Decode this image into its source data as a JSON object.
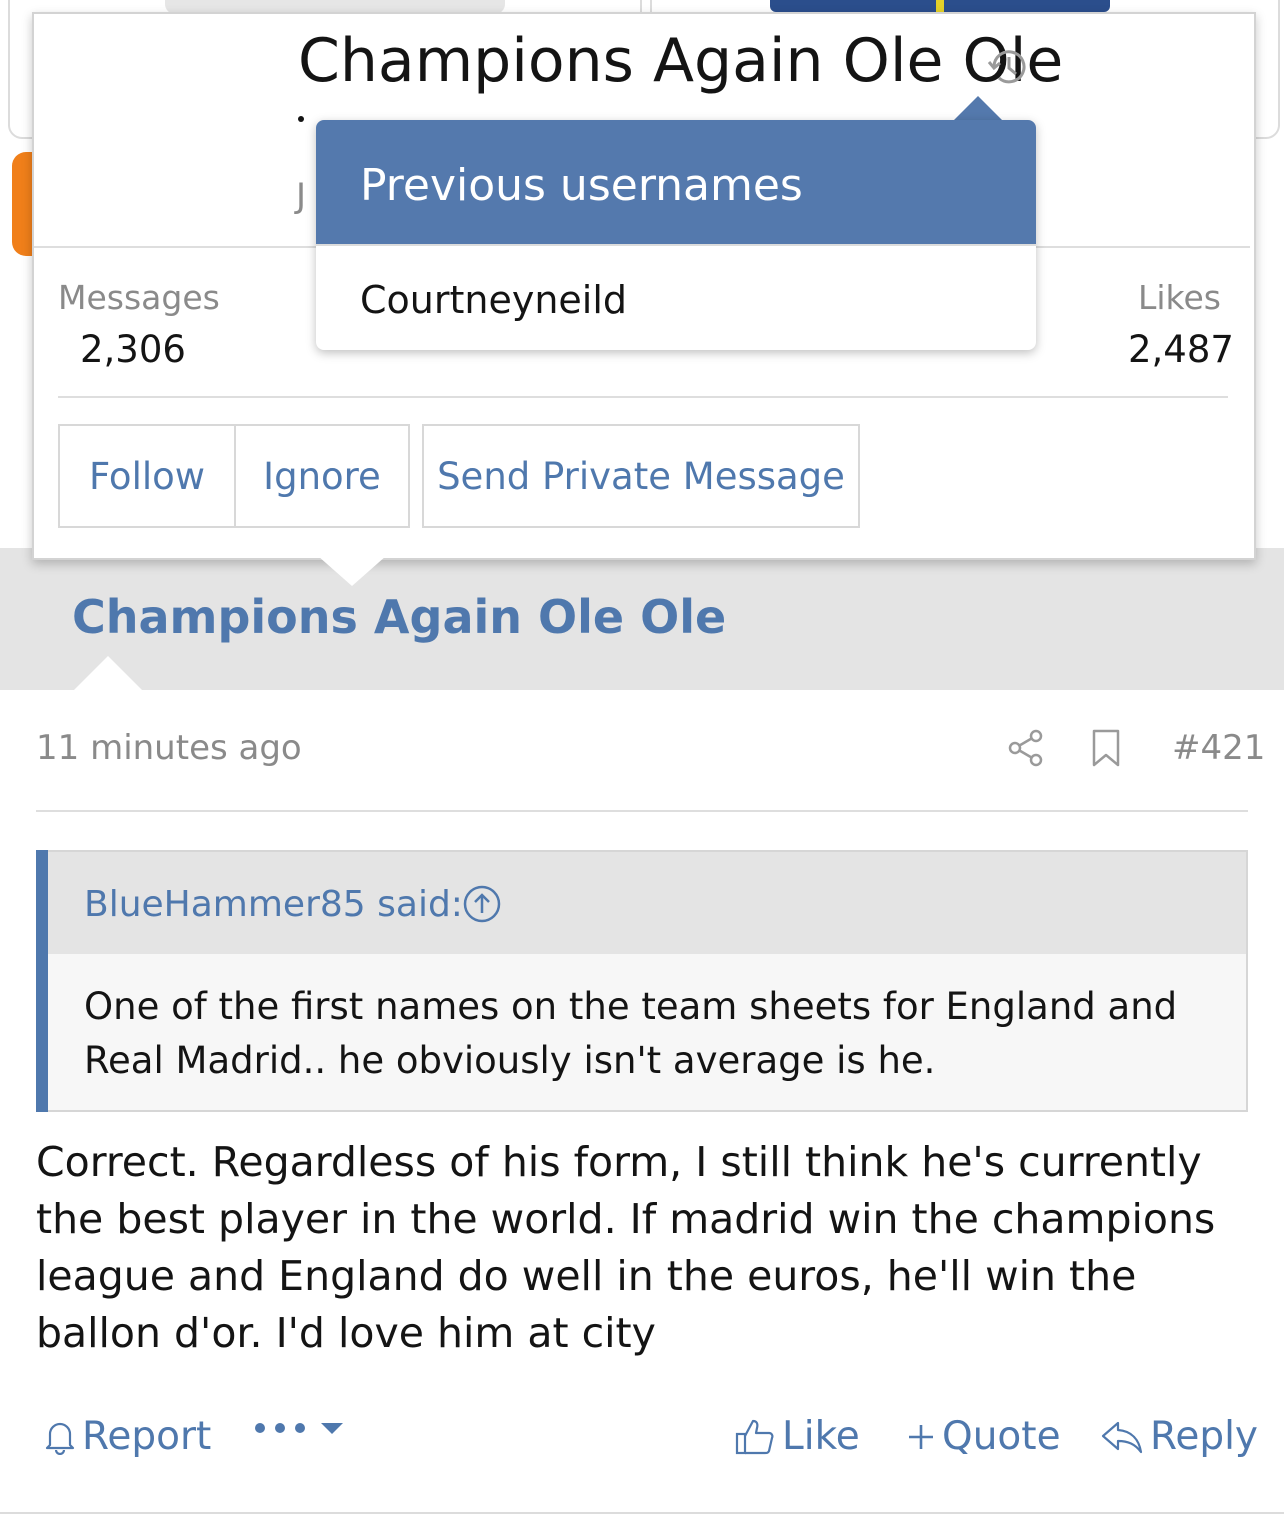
{
  "member_card": {
    "title": "Champions Again Ole Ole",
    "initial": "J",
    "stats": {
      "messages_label": "Messages",
      "messages_value": "2,306",
      "likes_label": "Likes",
      "likes_value": "2,487"
    },
    "buttons": {
      "follow": "Follow",
      "ignore": "Ignore",
      "message": "Send Private Message"
    }
  },
  "previous_usernames": {
    "header": "Previous usernames",
    "names": [
      "Courtneyneild"
    ]
  },
  "post": {
    "username": "Champions Again Ole Ole",
    "time": "11 minutes ago",
    "number": "#421",
    "quote": {
      "author": "BlueHammer85 said:",
      "text": "One of the first names on the team sheets for England and Real Madrid.. he obviously isn't average is he."
    },
    "body": "Correct. Regardless of his form, I still think he's currently the best player in the world. If madrid win the champions league and England do well in the euros, he'll win the ballon d'or. I'd love him at city",
    "actions": {
      "report": "Report",
      "like": "Like",
      "quote": "Quote",
      "reply": "Reply"
    }
  },
  "colors": {
    "accent": "#4f78ad",
    "popup_header": "#5479ad",
    "band": "#e4e4e4",
    "muted_text": "#8a8a8a"
  },
  "icons": [
    "history-icon",
    "share-icon",
    "bookmark-icon",
    "arrow-up-circle-icon",
    "bell-icon",
    "ellipsis-icon",
    "caret-down-icon",
    "thumbs-up-icon",
    "plus-icon",
    "reply-arrow-icon"
  ]
}
